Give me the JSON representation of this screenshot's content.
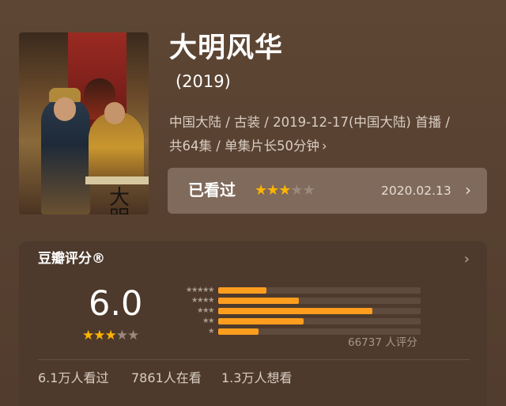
{
  "header": {
    "title": "大明风华",
    "year": "(2019)",
    "meta_line1": "中国大陆 / 古装 / 2019-12-17(中国大陆) 首播 /",
    "meta_line2": "共64集 / 单集片长50分钟",
    "poster_text": "大明"
  },
  "watched": {
    "label": "已看过",
    "user_rating_stars": 3,
    "date": "2020.02.13"
  },
  "douban": {
    "heading": "豆瓣评分®",
    "score": "6.0",
    "score_stars": 3,
    "rating_distribution_percent": [
      {
        "stars": 5,
        "value": 12
      },
      {
        "stars": 4,
        "value": 20
      },
      {
        "stars": 3,
        "value": 38
      },
      {
        "stars": 2,
        "value": 21
      },
      {
        "stars": 1,
        "value": 10
      }
    ],
    "rating_count": "66737 人评分",
    "stats": [
      "6.1万人看过",
      "7861人在看",
      "1.3万人想看"
    ]
  },
  "icons": {
    "star_filled": "star-icon",
    "star_empty": "star-outline-icon",
    "chevron": "chevron-right-icon"
  },
  "colors": {
    "accent_star": "#ffb400",
    "bar_fill": "#ff9d1e",
    "background": "#5a4230",
    "card": "#4d3a2c"
  }
}
